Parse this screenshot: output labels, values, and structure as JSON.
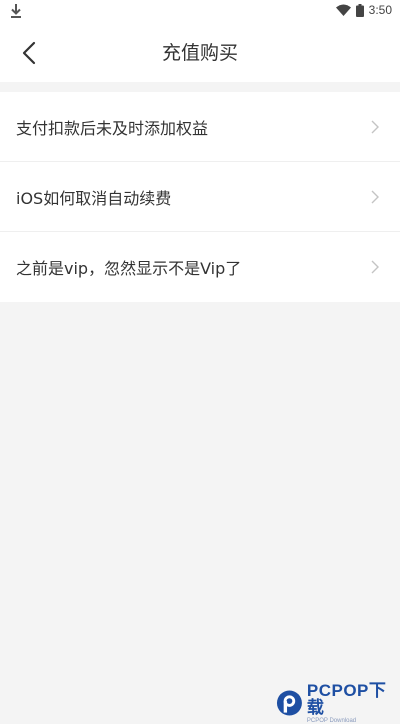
{
  "status_bar": {
    "time": "3:50",
    "download_icon": "download-icon",
    "wifi_icon": "wifi-icon",
    "battery_icon": "battery-icon"
  },
  "header": {
    "title": "充值购买",
    "back_icon": "chevron-left-icon"
  },
  "faq_items": [
    {
      "label": "支付扣款后未及时添加权益"
    },
    {
      "label": "iOS如何取消自动续费"
    },
    {
      "label": "之前是vip，忽然显示不是Vip了"
    }
  ],
  "watermark": {
    "brand": "PCPOP下载",
    "sub": "PCPOP Download",
    "color": "#1e4fa3"
  }
}
